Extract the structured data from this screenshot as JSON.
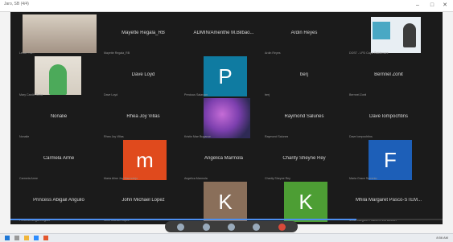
{
  "window": {
    "title": "Jaro, SB (4/4)",
    "minimize": "–",
    "maximize": "□",
    "close": "✕"
  },
  "participants": [
    {
      "name": "",
      "label": "Lester Tra...",
      "video": true
    },
    {
      "name": "Mayette Regala_RB",
      "label": "Mayette Regala_RB"
    },
    {
      "name": "ADMIN/Amenthe M.Bilbao...",
      "label": "",
      "full": "ADMIN/Amenthe M.Bilbao a..."
    },
    {
      "name": "Ardin Reyes",
      "label": "Ardin Reyes"
    },
    {
      "name": "",
      "label": "DOST - LPD Capiz Baldemore",
      "video": true
    },
    {
      "name": "",
      "label": "Mary Cardin Soria",
      "video": true
    },
    {
      "name": "Dave Loyd",
      "label": "Dave Loyd"
    },
    {
      "name": "",
      "label": "Precious Salarzon",
      "avatar": "P"
    },
    {
      "name": "berj",
      "label": "berj"
    },
    {
      "name": "Bernnel Zonit",
      "label": "Bernnel Zonit"
    },
    {
      "name": "Nonalie",
      "label": "Nonalie"
    },
    {
      "name": "Rhea Joy Villas",
      "label": "Rhea Joy Villas"
    },
    {
      "name": "",
      "label": "Kristin Mae Buganon",
      "video": true
    },
    {
      "name": "Raymond Salunes",
      "label": "Raymond Salunes"
    },
    {
      "name": "Dave Iompochtins",
      "label": "Dave Iompochtins"
    },
    {
      "name": "Carmela Arme",
      "label": "Carmela Arme"
    },
    {
      "name": "",
      "label": "Maria Aline Joy Marmolejo",
      "avatar": "m"
    },
    {
      "name": "Angelica Marmola",
      "label": "Angelica Marmola"
    },
    {
      "name": "Charity Sheyne Rey",
      "label": "Charity Sheyne Rey"
    },
    {
      "name": "",
      "label": "Maria Grace Sorrento",
      "avatar": "F"
    },
    {
      "name": "Princess Abigail Anguilo",
      "label": "Princess Abigail Anguilo"
    },
    {
      "name": "John Michael Lopez",
      "label": "John Michael Lopez"
    },
    {
      "name": "",
      "label": "",
      "avatar": "K"
    },
    {
      "name": "",
      "label": "",
      "avatar": "K"
    },
    {
      "name": "Mhila Margaret Pasco-STEM...",
      "label": "Mhila Margaret Pasco-STEM Adviser"
    }
  ],
  "colors": {
    "P": "#0f7ba1",
    "m": "#e04a1d",
    "F": "#1d5fb8",
    "K1": "#8a6f5a",
    "K2": "#4d9e34"
  },
  "progress": 0.8,
  "taskbar": {
    "clock": "8:56 AM"
  }
}
